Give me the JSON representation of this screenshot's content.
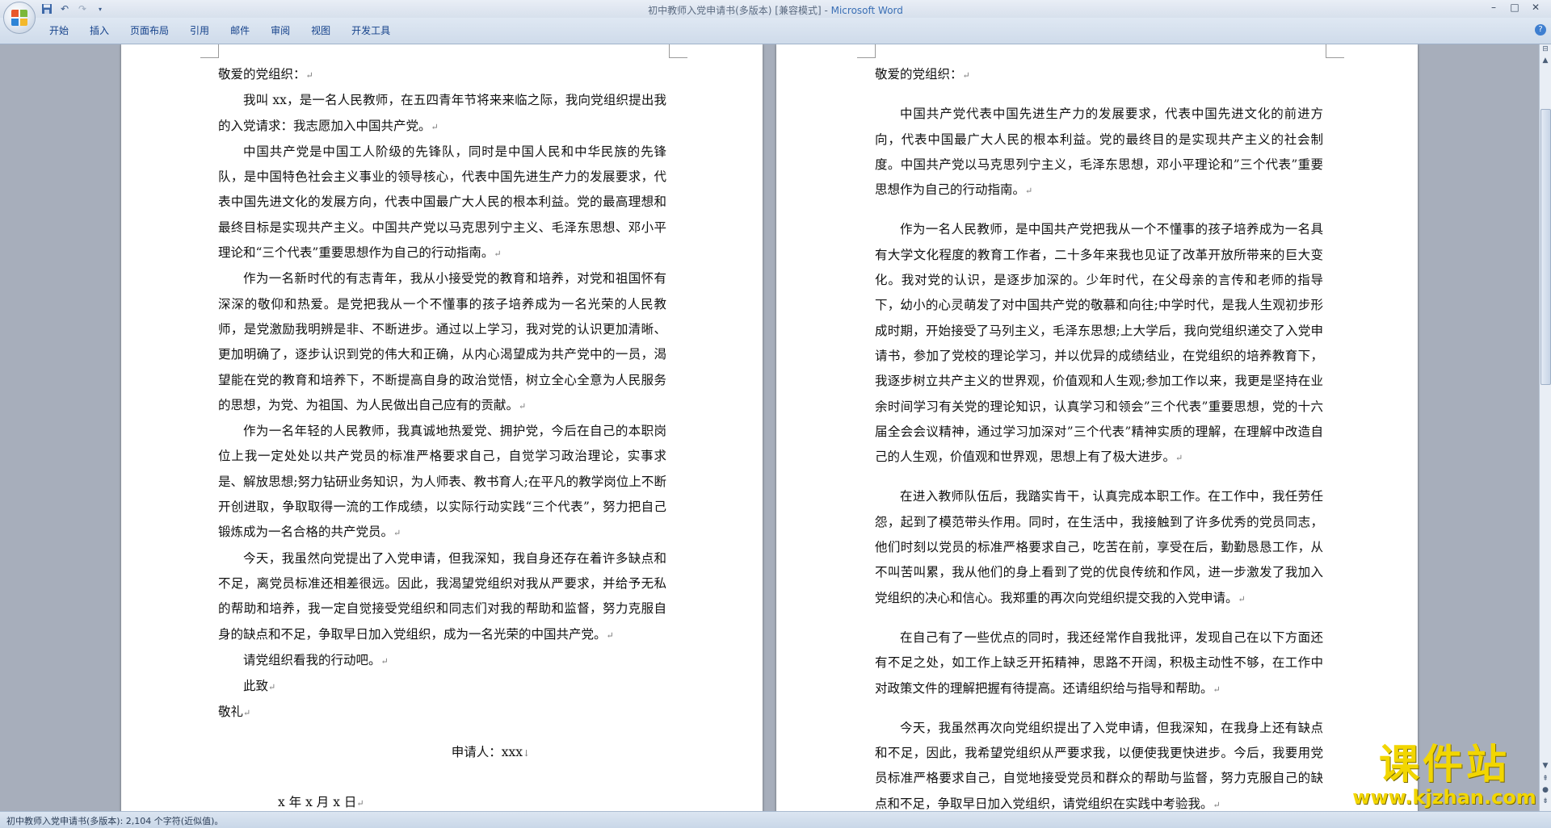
{
  "window": {
    "title_doc": "初中教师入党申请书(多版本) [兼容模式] - ",
    "title_app": "Microsoft Word",
    "controls": [
      "–",
      "□",
      "✕"
    ]
  },
  "quick_access": {
    "icons": [
      "save-icon",
      "undo-icon",
      "redo-icon",
      "customize-icon"
    ]
  },
  "ribbon": {
    "tabs": [
      "开始",
      "插入",
      "页面布局",
      "引用",
      "邮件",
      "审阅",
      "视图",
      "开发工具"
    ]
  },
  "colors": {
    "title_app": "#3a6fb5",
    "tab_text": "#15428b",
    "workspace_bg": "#a7aebb",
    "watermark": "#f2d600"
  },
  "page1": {
    "salutation": "敬爱的党组织：",
    "paragraphs": [
      "我叫 xx，是一名人民教师，在五四青年节将来来临之际，我向党组织提出我的入党请求：我志愿加入中国共产党。",
      "中国共产党是中国工人阶级的先锋队，同时是中国人民和中华民族的先锋队，是中国特色社会主义事业的领导核心，代表中国先进生产力的发展要求，代表中国先进文化的发展方向，代表中国最广大人民的根本利益。党的最高理想和最终目标是实现共产主义。中国共产党以马克思列宁主义、毛泽东思想、邓小平理论和“三个代表”重要思想作为自己的行动指南。",
      "作为一名新时代的有志青年，我从小接受党的教育和培养，对党和祖国怀有深深的敬仰和热爱。是党把我从一个不懂事的孩子培养成为一名光荣的人民教师，是党激励我明辨是非、不断进步。通过以上学习，我对党的认识更加清晰、更加明确了，逐步认识到党的伟大和正确，从内心渴望成为共产党中的一员，渴望能在党的教育和培养下，不断提高自身的政治觉悟，树立全心全意为人民服务的思想，为党、为祖国、为人民做出自己应有的贡献。",
      "作为一名年轻的人民教师，我真诚地热爱党、拥护党，今后在自己的本职岗位上我一定处处以共产党员的标准严格要求自己，自觉学习政治理论，实事求是、解放思想;努力钻研业务知识，为人师表、教书育人;在平凡的教学岗位上不断开创进取，争取取得一流的工作成绩，以实际行动实践“三个代表”，努力把自己锻炼成为一名合格的共产党员。",
      "今天，我虽然向党提出了入党申请，但我深知，我自身还存在着许多缺点和不足，离党员标准还相差很远。因此，我渴望党组织对我从严要求，并给予无私的帮助和培养，我一定自觉接受党组织和同志们对我的帮助和监督，努力克服自身的缺点和不足，争取早日加入党组织，成为一名光荣的中国共产党。",
      "请党组织看我的行动吧。",
      "此致"
    ],
    "closing": "敬礼",
    "applicant": "申请人：xxx",
    "date": "x 年 x 月 x 日"
  },
  "page2": {
    "salutation": "敬爱的党组织：",
    "paragraphs": [
      "中国共产党代表中国先进生产力的发展要求，代表中国先进文化的前进方向，代表中国最广大人民的根本利益。党的最终目的是实现共产主义的社会制度。中国共产党以马克思列宁主义，毛泽东思想，邓小平理论和”三个代表”重要思想作为自己的行动指南。",
      "作为一名人民教师，是中国共产党把我从一个不懂事的孩子培养成为一名具有大学文化程度的教育工作者，二十多年来我也见证了改革开放所带来的巨大变化。我对党的认识，是逐步加深的。少年时代，在父母亲的言传和老师的指导下，幼小的心灵萌发了对中国共产党的敬慕和向往;中学时代，是我人生观初步形成时期，开始接受了马列主义，毛泽东思想;上大学后，我向党组织递交了入党申请书，参加了党校的理论学习，并以优异的成绩结业，在党组织的培养教育下，我逐步树立共产主义的世界观，价值观和人生观;参加工作以来，我更是坚持在业余时间学习有关党的理论知识，认真学习和领会”三个代表”重要思想，党的十六届全会会议精神，通过学习加深对”三个代表”精神实质的理解，在理解中改造自己的人生观，价值观和世界观，思想上有了极大进步。",
      "在进入教师队伍后，我踏实肯干，认真完成本职工作。在工作中，我任劳任怨，起到了模范带头作用。同时，在生活中，我接触到了许多优秀的党员同志，他们时刻以党员的标准严格要求自己，吃苦在前，享受在后，勤勤恳恳工作，从不叫苦叫累，我从他们的身上看到了党的优良传统和作风，进一步激发了我加入党组织的决心和信心。我郑重的再次向党组织提交我的入党申请。",
      "在自己有了一些优点的同时，我还经常作自我批评，发现自己在以下方面还有不足之处，如工作上缺乏开拓精神，思路不开阔，积极主动性不够，在工作中对政策文件的理解把握有待提高。还请组织给与指导和帮助。",
      "今天，我虽然再次向党组织提出了入党申请，但我深知，在我身上还有缺点和不足，因此，我希望党组织从严要求我，以便使我更快进步。今后，我要用党员标准严格要求自己，自觉地接受党员和群众的帮助与监督，努力克服自己的缺点和不足，争取早日加入党组织，请党组织在实践中考验我。"
    ]
  },
  "status": {
    "text": "初中教师入党申请书(多版本): 2,104 个字符(近似值)。"
  },
  "watermark": {
    "main": "课件站",
    "url": "www.kjzhan.com"
  }
}
